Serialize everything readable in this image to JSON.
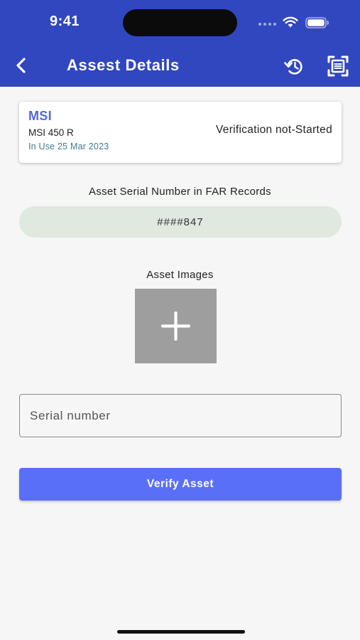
{
  "status_bar": {
    "time": "9:41"
  },
  "header": {
    "title": "Assest Details",
    "background_color": "#3147c0",
    "icons": {
      "back": "chevron-left-icon",
      "history": "history-icon",
      "scan": "scan-icon"
    }
  },
  "asset": {
    "brand": "MSI",
    "model": "MSI 450 R",
    "usage": "In Use 25 Mar 2023",
    "verification_status": "Verification not-Started",
    "brand_color": "#5268d8"
  },
  "far_records": {
    "label": "Asset Serial Number in FAR Records",
    "serial": "####847"
  },
  "images": {
    "label": "Asset Images",
    "add_icon": "plus-icon"
  },
  "serial_input": {
    "placeholder": "Serial number",
    "value": ""
  },
  "actions": {
    "verify_label": "Verify Asset",
    "verify_color": "#5a6ff7"
  }
}
